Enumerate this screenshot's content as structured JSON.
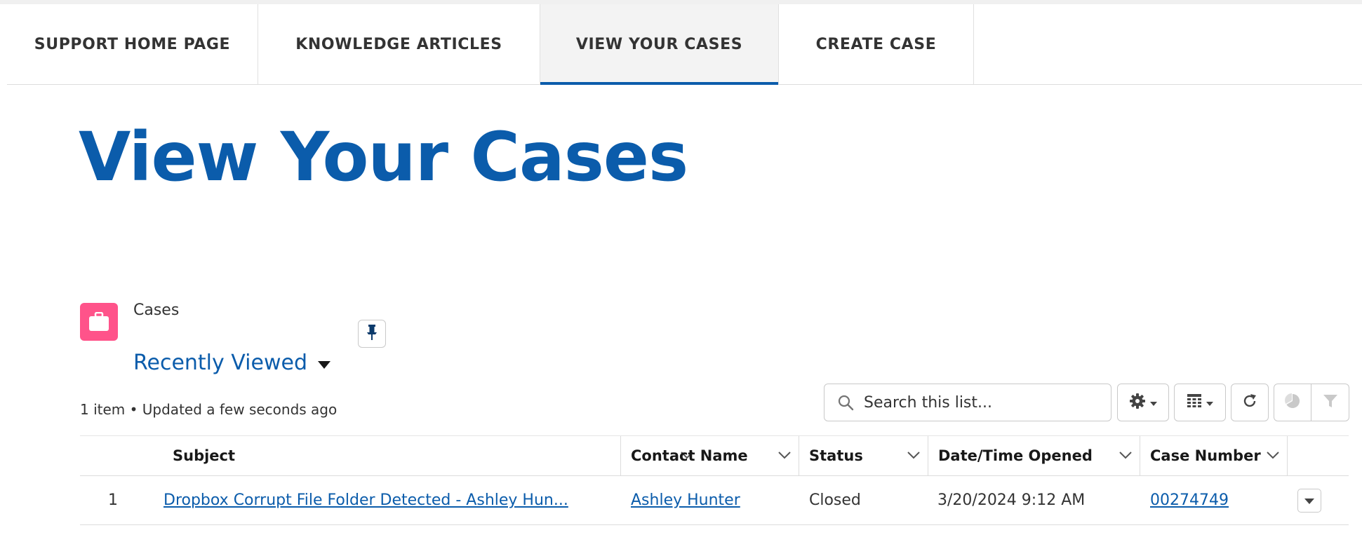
{
  "nav": {
    "tabs": [
      {
        "label": "SUPPORT HOME PAGE"
      },
      {
        "label": "KNOWLEDGE ARTICLES"
      },
      {
        "label": "VIEW YOUR CASES",
        "active": true
      },
      {
        "label": "CREATE CASE"
      }
    ]
  },
  "page": {
    "title": "View Your Cases"
  },
  "list": {
    "object_label": "Cases",
    "object_icon": "briefcase-icon",
    "object_icon_color": "#ff538a",
    "view_name": "Recently Viewed",
    "meta": "1 item • Updated a few seconds ago",
    "search_placeholder": "Search this list...",
    "toolbar_icons": [
      "gear-icon",
      "table-icon",
      "refresh-icon",
      "pie-chart-icon",
      "filter-icon"
    ]
  },
  "table": {
    "columns": [
      "Subject",
      "Contact Name",
      "Status",
      "Date/Time Opened",
      "Case Number"
    ],
    "rows": [
      {
        "num": "1",
        "subject": "Dropbox Corrupt File Folder Detected - Ashley Hun...",
        "contact": "Ashley Hunter",
        "status": "Closed",
        "opened": "3/20/2024 9:12 AM",
        "case_number": "00274749"
      }
    ]
  },
  "colors": {
    "brand": "#0b5cab",
    "text": "#181818",
    "border": "#c9c9c9"
  }
}
